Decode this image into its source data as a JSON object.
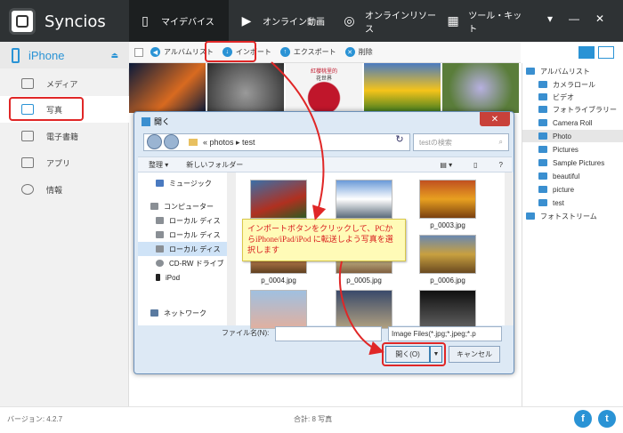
{
  "app": {
    "name": "Syncios"
  },
  "nav": [
    {
      "label": "マイデバイス",
      "icon": "phone-icon"
    },
    {
      "label": "オンライン動画",
      "icon": "play-icon"
    },
    {
      "label": "オンラインリソース",
      "icon": "globe-icon"
    },
    {
      "label": "ツール・キット",
      "icon": "grid-icon"
    }
  ],
  "device": {
    "name": "iPhone"
  },
  "sidebar": {
    "items": [
      {
        "label": "メディア"
      },
      {
        "label": "写真"
      },
      {
        "label": "電子書籍"
      },
      {
        "label": "アプリ"
      },
      {
        "label": "情報"
      }
    ]
  },
  "toolbar": {
    "album_list": "アルバムリスト",
    "import": "インポート",
    "export": "エクスポート",
    "delete": "削除"
  },
  "photo_strip": {
    "caption1": "紅櫻桃里的",
    "caption2": "花世界"
  },
  "right_panel": {
    "items": [
      {
        "label": "アルバムリスト"
      },
      {
        "label": "カメラロール"
      },
      {
        "label": "ビデオ"
      },
      {
        "label": "フォトライブラリー"
      },
      {
        "label": "Camera Roll"
      },
      {
        "label": "Photo"
      },
      {
        "label": "Pictures"
      },
      {
        "label": "Sample Pictures"
      },
      {
        "label": "beautiful"
      },
      {
        "label": "picture"
      },
      {
        "label": "test"
      },
      {
        "label": "フォトストリーム"
      }
    ]
  },
  "dialog": {
    "title": "開く",
    "path": "« photos ▸ test",
    "search_placeholder": "testの検索",
    "organize": "整理 ▾",
    "new_folder": "新しいフォルダー",
    "tree": [
      {
        "label": "ミュージック"
      },
      {
        "label": "コンピューター"
      },
      {
        "label": "ローカル ディス"
      },
      {
        "label": "ローカル ディス"
      },
      {
        "label": "ローカル ディス"
      },
      {
        "label": "CD-RW ドライブ"
      },
      {
        "label": "iPod"
      },
      {
        "label": "ネットワーク"
      }
    ],
    "files": [
      {
        "name": ""
      },
      {
        "name": ""
      },
      {
        "name": "p_0003.jpg"
      },
      {
        "name": "p_0004.jpg"
      },
      {
        "name": "p_0005.jpg"
      },
      {
        "name": "p_0006.jpg"
      }
    ],
    "filename_label": "ファイル名(N):",
    "filetype": "Image Files(*.jpg;*.jpeg;*.p",
    "open": "開く(O)",
    "cancel": "キャンセル"
  },
  "callout": {
    "text": "インポートボタンをクリックして、PCからiPhone/iPad/iPod に転送しよう写真を選択します"
  },
  "footer": {
    "version": "バージョン: 4.2.7",
    "total": "合計: 8 写真"
  },
  "colors": {
    "accent": "#2a93d5",
    "highlight": "#e02727",
    "header": "#2e3234"
  }
}
